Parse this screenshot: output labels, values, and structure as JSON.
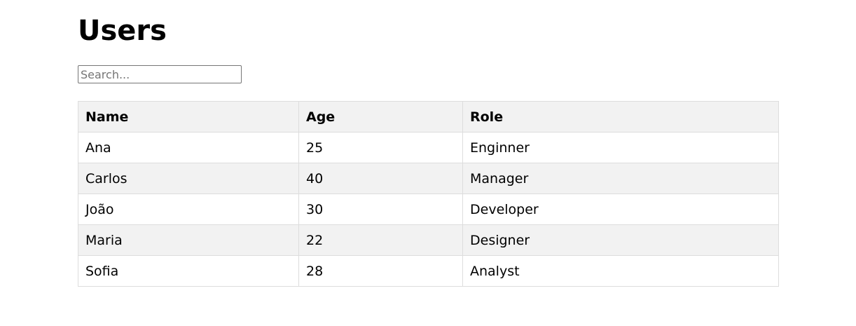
{
  "page": {
    "title": "Users"
  },
  "search": {
    "placeholder": "Search...",
    "value": ""
  },
  "table": {
    "headers": [
      "Name",
      "Age",
      "Role"
    ],
    "rows": [
      [
        "Ana",
        "25",
        "Enginner"
      ],
      [
        "Carlos",
        "40",
        "Manager"
      ],
      [
        "João",
        "30",
        "Developer"
      ],
      [
        "Maria",
        "22",
        "Designer"
      ],
      [
        "Sofia",
        "28",
        "Analyst"
      ]
    ]
  },
  "colors": {
    "header_bg": "#f2f2f2",
    "row_alt_bg": "#f2f2f2",
    "border": "#dddddd"
  }
}
